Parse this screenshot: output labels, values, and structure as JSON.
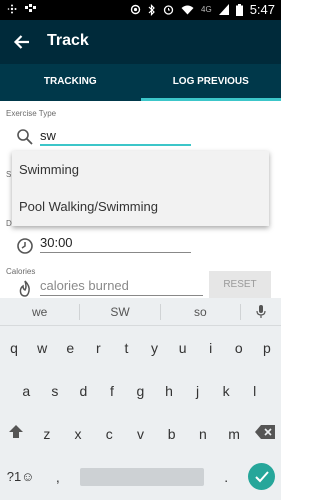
{
  "status_bar": {
    "network": "4G",
    "time": "5:47"
  },
  "app_bar": {
    "title": "Track"
  },
  "tabs": [
    {
      "label": "TRACKING",
      "active": false
    },
    {
      "label": "LOG PREVIOUS",
      "active": true
    }
  ],
  "exercise_type": {
    "label": "Exercise Type",
    "value": "sw"
  },
  "dropdown": {
    "options": [
      "Swimming",
      "Pool Walking/Swimming"
    ]
  },
  "duration": {
    "label": "D",
    "value": "30:00"
  },
  "start_label_fragment": "S",
  "calories": {
    "label": "Calories",
    "placeholder": "calories burned",
    "reset_label": "RESET"
  },
  "keyboard": {
    "suggestions": [
      "we",
      "SW",
      "so"
    ],
    "row1": [
      "q",
      "w",
      "e",
      "r",
      "t",
      "y",
      "u",
      "i",
      "o",
      "p"
    ],
    "row2": [
      "a",
      "s",
      "d",
      "f",
      "g",
      "h",
      "j",
      "k",
      "l"
    ],
    "row3": [
      "z",
      "x",
      "c",
      "v",
      "b",
      "n",
      "m"
    ],
    "symbols_label": "?1☺",
    "comma": ",",
    "period": "."
  },
  "colors": {
    "app_bar": "#002a3a",
    "tab_bar": "#00384a",
    "accent": "#3cc6c9",
    "enter": "#26a69a"
  }
}
